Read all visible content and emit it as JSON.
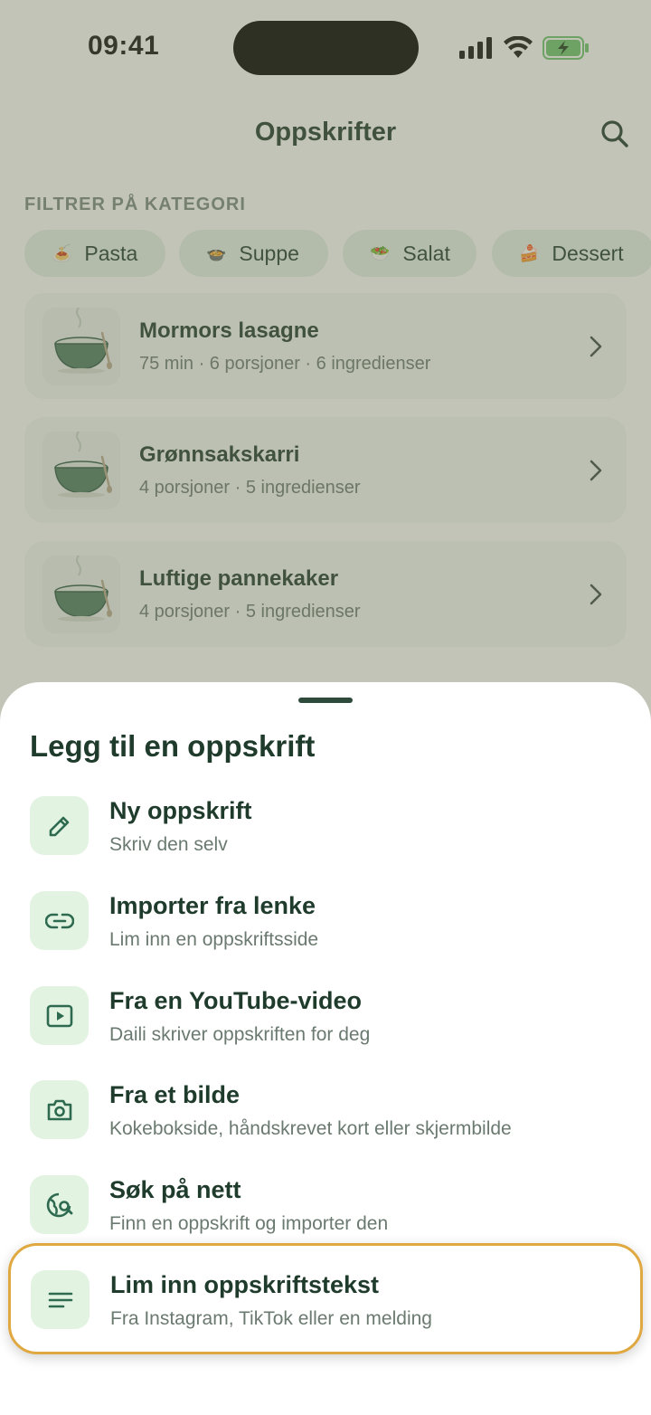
{
  "status_bar": {
    "time": "09:41"
  },
  "header": {
    "title": "Oppskrifter"
  },
  "filters": {
    "label": "FILTRER PÅ KATEGORI",
    "chips": [
      {
        "emoji": "🍝",
        "label": "Pasta"
      },
      {
        "emoji": "🍲",
        "label": "Suppe"
      },
      {
        "emoji": "🥗",
        "label": "Salat"
      },
      {
        "emoji": "🍰",
        "label": "Dessert"
      }
    ]
  },
  "recipes": [
    {
      "title": "Mormors lasagne",
      "meta": "75 min · 6 porsjoner · 6 ingredienser"
    },
    {
      "title": "Grønnsakskarri",
      "meta": "4 porsjoner · 5 ingredienser"
    },
    {
      "title": "Luftige pannekaker",
      "meta": "4 porsjoner · 5 ingredienser"
    }
  ],
  "sheet": {
    "title": "Legg til en oppskrift",
    "options": [
      {
        "icon": "pencil-icon",
        "label": "Ny oppskrift",
        "sub": "Skriv den selv"
      },
      {
        "icon": "link-icon",
        "label": "Importer fra lenke",
        "sub": "Lim inn en oppskriftsside"
      },
      {
        "icon": "play-icon",
        "label": "Fra en YouTube-video",
        "sub": "Daili skriver oppskriften for deg"
      },
      {
        "icon": "camera-icon",
        "label": "Fra et bilde",
        "sub": "Kokebokside, håndskrevet kort eller skjermbilde"
      },
      {
        "icon": "globe-search-icon",
        "label": "Søk på nett",
        "sub": "Finn en oppskrift og importer den"
      },
      {
        "icon": "text-lines-icon",
        "label": "Lim inn oppskriftstekst",
        "sub": "Fra Instagram, TikTok eller en melding"
      }
    ]
  },
  "colors": {
    "accent": "#2d6a4f",
    "icon_bg": "#e3f3e2",
    "highlight_border": "#e0a840",
    "scrim": "#6e7256"
  }
}
